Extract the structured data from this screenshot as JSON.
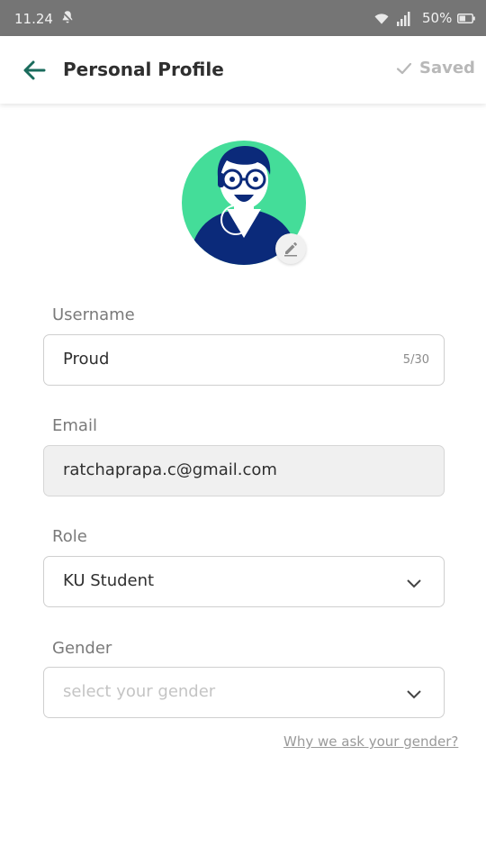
{
  "status_bar": {
    "time": "11.24",
    "battery": "50%"
  },
  "header": {
    "title": "Personal Profile",
    "saved_label": "Saved"
  },
  "form": {
    "username": {
      "label": "Username",
      "value": "Proud",
      "counter": "5/30"
    },
    "email": {
      "label": "Email",
      "value": "ratchaprapa.c@gmail.com"
    },
    "role": {
      "label": "Role",
      "value": "KU Student"
    },
    "gender": {
      "label": "Gender",
      "placeholder": "select your gender"
    }
  },
  "help_link": "Why we ask your gender?",
  "icons": {
    "back": "arrow-left-icon",
    "saved": "check-icon",
    "edit": "pencil-icon",
    "dropdown": "chevron-down-icon"
  },
  "colors": {
    "accent": "#1a6b5c",
    "avatar_bg": "#44dd99",
    "avatar_shirt": "#0b2a7a"
  }
}
